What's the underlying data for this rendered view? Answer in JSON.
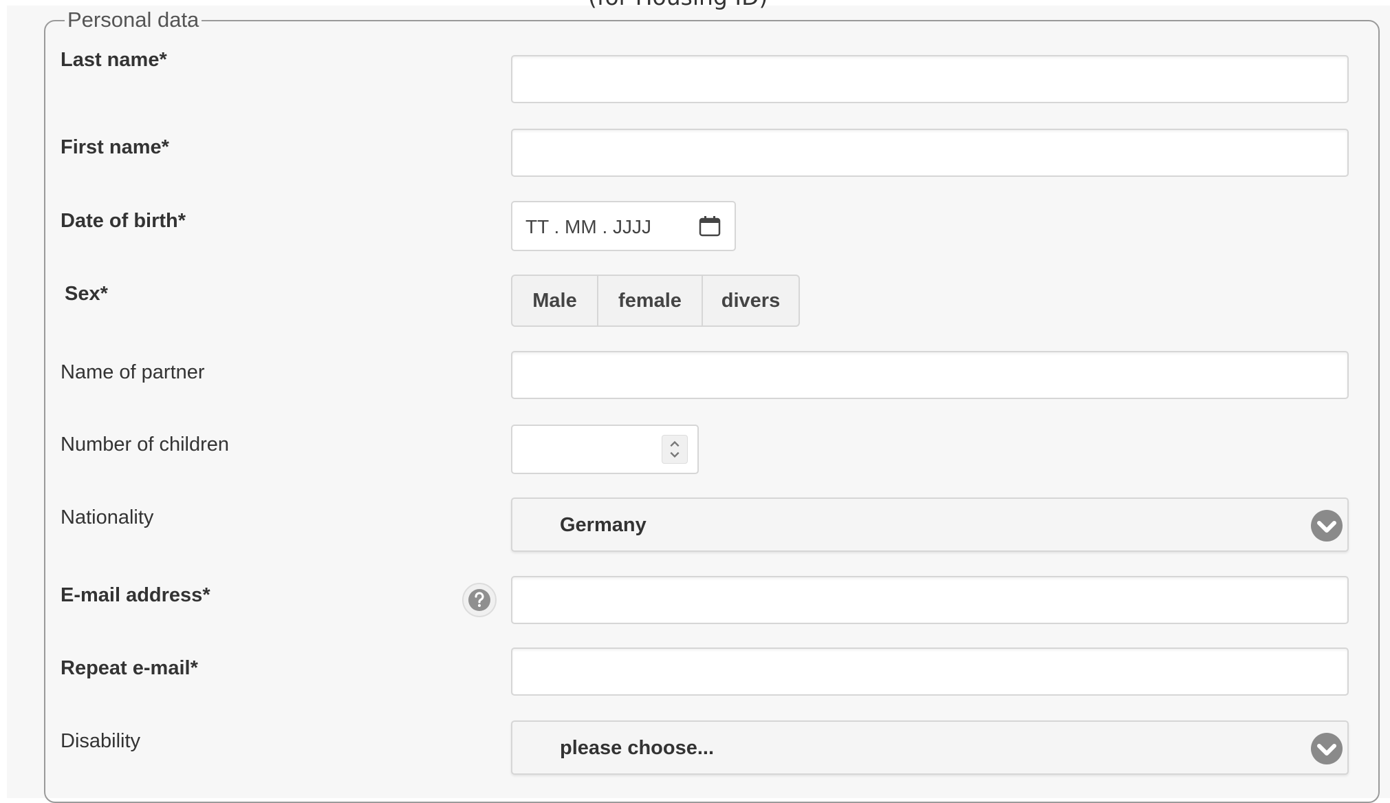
{
  "header": {
    "cut_title": "(for Housing ID)"
  },
  "form": {
    "legend": "Personal data",
    "last_name_label": "Last name*",
    "first_name_label": "First name*",
    "dob_label": "Date of birth*",
    "dob_placeholder": "TT . MM . JJJJ",
    "sex_label": "Sex*",
    "sex_options": [
      "Male",
      "female",
      "divers"
    ],
    "partner_label": "Name of partner",
    "children_label": "Number of children",
    "nationality_label": "Nationality",
    "nationality_value": "Germany",
    "email_label": "E-mail address*",
    "repeat_email_label": "Repeat e-mail*",
    "disability_label": "Disability",
    "disability_value": "please choose..."
  },
  "icons": {
    "calendar": "calendar-icon",
    "spinner": "number-spinner-icon",
    "dropdown": "chevron-down-circle-icon",
    "help": "question-circle-icon"
  },
  "colors": {
    "background": "#f7f7f7",
    "border": "#d6d6d6",
    "fieldset_border": "#9a9a9a",
    "icon_gray": "#888888"
  }
}
